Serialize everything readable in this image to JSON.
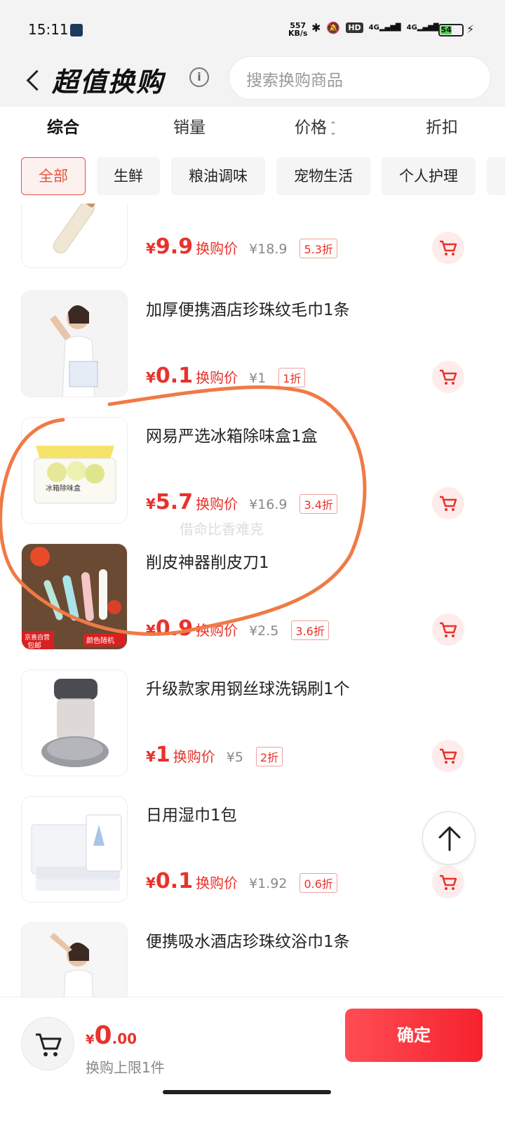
{
  "status": {
    "time": "15:11",
    "speed_value": "557",
    "speed_unit": "KB/s",
    "hd": "HD",
    "net1": "4G",
    "net2": "4G",
    "battery": "54"
  },
  "header": {
    "title": "超值换购",
    "info_icon": "info-icon",
    "search_placeholder": "搜索换购商品"
  },
  "sort_tabs": [
    "综合",
    "销量",
    "价格",
    "折扣"
  ],
  "categories": [
    "全部",
    "生鲜",
    "粮油调味",
    "宠物生活",
    "个人护理"
  ],
  "price_label": "换购价",
  "products": [
    {
      "name": "",
      "yen": "¥",
      "price": "9.9",
      "orig": "¥18.9",
      "discount": "5.3折"
    },
    {
      "name": "加厚便携酒店珍珠纹毛巾1条",
      "yen": "¥",
      "price": "0.1",
      "orig": "¥1",
      "discount": "1折"
    },
    {
      "name": "网易严选冰箱除味盒1盒",
      "yen": "¥",
      "price": "5.7",
      "orig": "¥16.9",
      "discount": "3.4折",
      "thumb_text": "冰箱除味盒"
    },
    {
      "name": "削皮神器削皮刀1",
      "yen": "¥",
      "price": "0.9",
      "orig": "¥2.5",
      "discount": "3.6折",
      "thumb_badge1": "京喜自营",
      "thumb_badge2": "包邮",
      "thumb_badge3": "颜色随机"
    },
    {
      "name": "升级款家用钢丝球洗锅刷1个",
      "yen": "¥",
      "price": "1",
      "orig": "¥5",
      "discount": "2折"
    },
    {
      "name": "日用湿巾1包",
      "yen": "¥",
      "price": "0.1",
      "orig": "¥1.92",
      "discount": "0.6折"
    },
    {
      "name": "便携吸水酒店珍珠纹浴巾1条",
      "yen": "",
      "price": "",
      "orig": "",
      "discount": ""
    }
  ],
  "bottom": {
    "yen": "¥",
    "total_big": "0",
    "total_small": ".00",
    "limit": "换购上限1件",
    "confirm": "确定"
  },
  "watermark": "借命比香难克",
  "colors": {
    "accent": "#e8322b",
    "annotation": "#f07a45"
  }
}
